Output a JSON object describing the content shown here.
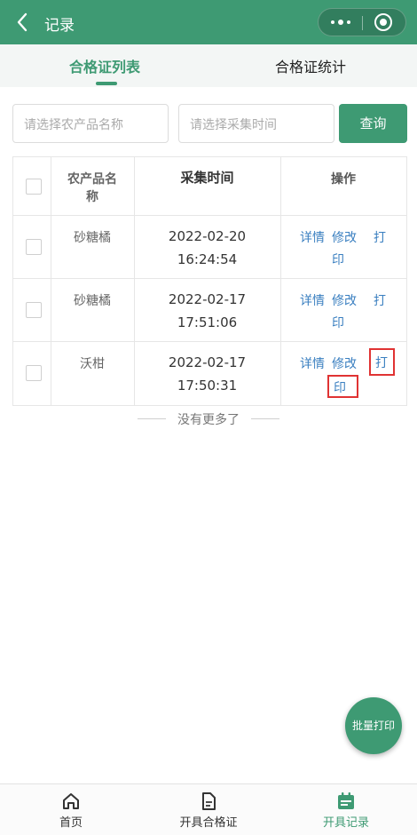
{
  "header": {
    "title": "记录"
  },
  "tabs": [
    {
      "label": "合格证列表",
      "active": true
    },
    {
      "label": "合格证统计",
      "active": false
    }
  ],
  "filters": {
    "product_placeholder": "请选择农产品名称",
    "time_placeholder": "请选择采集时间",
    "query_label": "查询"
  },
  "table": {
    "headers": {
      "product_line1": "农产品名",
      "product_line2": "称",
      "time": "采集时间",
      "ops": "操作"
    },
    "rows": [
      {
        "product": "砂糖橘",
        "date": "2022-02-20",
        "clock": "16:24:54"
      },
      {
        "product": "砂糖橘",
        "date": "2022-02-17",
        "clock": "17:51:06"
      },
      {
        "product": "沃柑",
        "date": "2022-02-17",
        "clock": "17:50:31"
      }
    ],
    "actions": {
      "detail": "详情",
      "edit": "修改",
      "print_1": "打",
      "print_2": "印"
    }
  },
  "no_more": "没有更多了",
  "fab_label": "批量打印",
  "bottom_nav": [
    {
      "label": "首页",
      "icon": "home-icon",
      "active": false
    },
    {
      "label": "开具合格证",
      "icon": "document-icon",
      "active": false
    },
    {
      "label": "开具记录",
      "icon": "calendar-icon",
      "active": true
    }
  ],
  "colors": {
    "primary": "#3e9a73",
    "link": "#3a7fc0",
    "highlight": "#e03333"
  }
}
